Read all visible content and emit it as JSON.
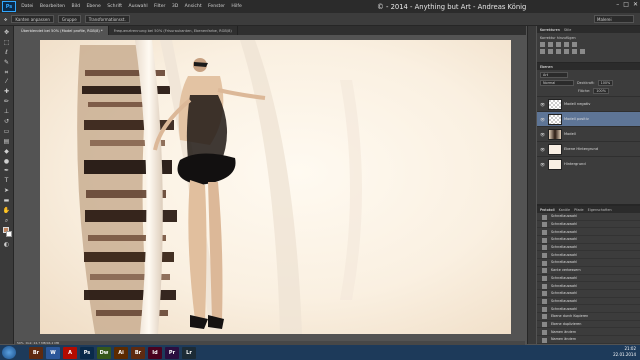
{
  "app": {
    "logo": "Ps"
  },
  "menu": [
    "Datei",
    "Bearbeiten",
    "Bild",
    "Ebene",
    "Schrift",
    "Auswahl",
    "Filter",
    "3D",
    "Ansicht",
    "Fenster",
    "Hilfe"
  ],
  "watermark": "© - 2014 - Anything but Art - Andreas König",
  "window_controls": {
    "min": "–",
    "max": "□",
    "close": "✕"
  },
  "options_bar": {
    "items": [
      "Kanten anpassen",
      "Gruppe",
      "Transformationsst."
    ],
    "workspace": "Malerei"
  },
  "tabs": [
    {
      "label": "Überblendet bei 50% (Model profile, RGB/8) *",
      "active": true
    },
    {
      "label": "Frequenztrennung bei 50% (Frisuraukanten, Ebenenfarbe, RGB/8)",
      "active": false
    }
  ],
  "status": {
    "zoom": "50%",
    "doc": "Dok: 24,7 MB/94,2 MB"
  },
  "panels": {
    "tabs": [
      "Korrekturen",
      "Stile"
    ],
    "adjust_title": "Korrektur hinzufügen",
    "layers_tab": "Ebenen",
    "kind": "Art",
    "blend": "Normal",
    "opacity_label": "Deckkraft:",
    "opacity": "100%",
    "fill_label": "Fläche:",
    "fill": "100%",
    "layers": [
      {
        "name": "Modell negativ",
        "thumb": "checker",
        "selected": false
      },
      {
        "name": "Modell positiv",
        "thumb": "checker",
        "selected": true
      },
      {
        "name": "Modell",
        "thumb": "pic",
        "selected": false
      },
      {
        "name": "Ebene Hintergrund",
        "thumb": "white",
        "selected": false
      },
      {
        "name": "Hintergrund",
        "thumb": "white",
        "selected": false
      }
    ],
    "history_tabs": [
      "Protokoll",
      "Kanäle",
      "Pfade",
      "Eigenschaften"
    ],
    "history": [
      "Schnellauswahl",
      "Schnellauswahl",
      "Schnellauswahl",
      "Schnellauswahl",
      "Schnellauswahl",
      "Schnellauswahl",
      "Schnellauswahl",
      "Kante verbessern",
      "Schnellauswahl",
      "Schnellauswahl",
      "Schnellauswahl",
      "Schnellauswahl",
      "Schnellauswahl",
      "Ebene durch Kopieren",
      "Ebene duplizieren",
      "Namen ändern",
      "Namen ändern",
      "Verschieben",
      "Verflüssigen"
    ]
  },
  "taskbar": {
    "apps": [
      {
        "name": "Br",
        "color": "#5e2a10"
      },
      {
        "name": "W",
        "color": "#2b579a"
      },
      {
        "name": "A",
        "color": "#b30b00"
      },
      {
        "name": "Ps",
        "color": "#0a2a4a"
      },
      {
        "name": "Dw",
        "color": "#35571a"
      },
      {
        "name": "Ai",
        "color": "#5c2a00"
      },
      {
        "name": "Br",
        "color": "#5e2a10"
      },
      {
        "name": "Id",
        "color": "#49021f"
      },
      {
        "name": "Pr",
        "color": "#2a0e3f"
      },
      {
        "name": "Lr",
        "color": "#1c2b36"
      }
    ],
    "time": "21:02",
    "date": "22.01.2014"
  }
}
